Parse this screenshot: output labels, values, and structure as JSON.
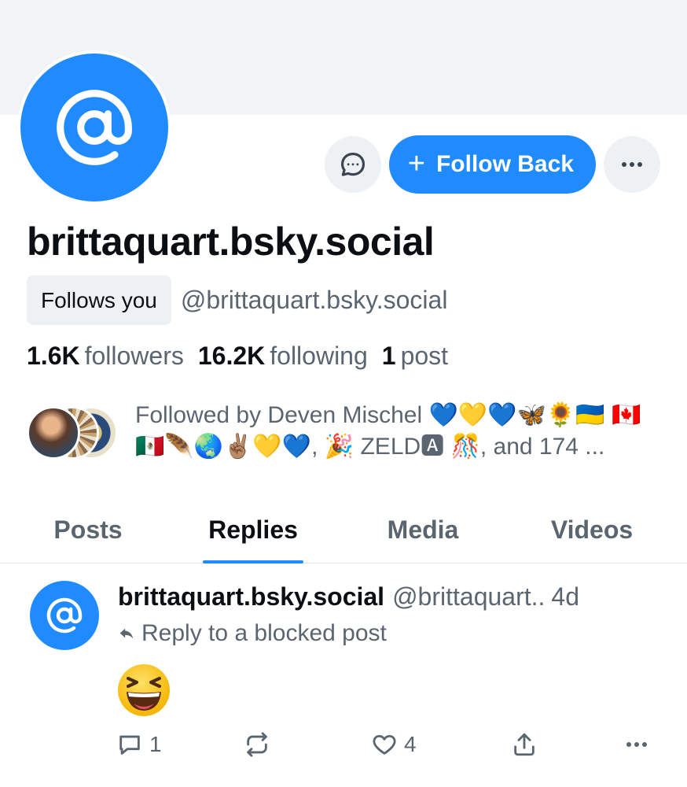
{
  "profile": {
    "display_name": "brittaquart.bsky.social",
    "follows_you": "Follows you",
    "handle": "@brittaquart.bsky.social",
    "avatar_icon": "at-sign-icon",
    "accent_color": "#208bfe"
  },
  "actions": {
    "message_icon": "message-icon",
    "follow_back_label": "Follow Back",
    "more_icon": "more-icon"
  },
  "stats": {
    "followers_count": "1.6K",
    "followers_label": "followers",
    "following_count": "16.2K",
    "following_label": "following",
    "posts_count": "1",
    "posts_label": "post"
  },
  "followed_by": {
    "text": "Followed by Deven Mischel 💙💛💙🦋🌻🇺🇦 🇨🇦🇲🇽🪶🌏✌🏽💛💙, 🎉 ZELD🅰 🎊, and 174 ..."
  },
  "tabs": [
    {
      "label": "Posts",
      "active": false
    },
    {
      "label": "Replies",
      "active": true
    },
    {
      "label": "Media",
      "active": false
    },
    {
      "label": "Videos",
      "active": false
    }
  ],
  "post": {
    "author_name": "brittaquart.bsky.social",
    "author_handle": "@brittaquart..",
    "time": "4d",
    "reply_to": "Reply to a blocked post",
    "emoji": "laughing-face",
    "reply_count": "1",
    "repost_count": "",
    "like_count": "4"
  }
}
